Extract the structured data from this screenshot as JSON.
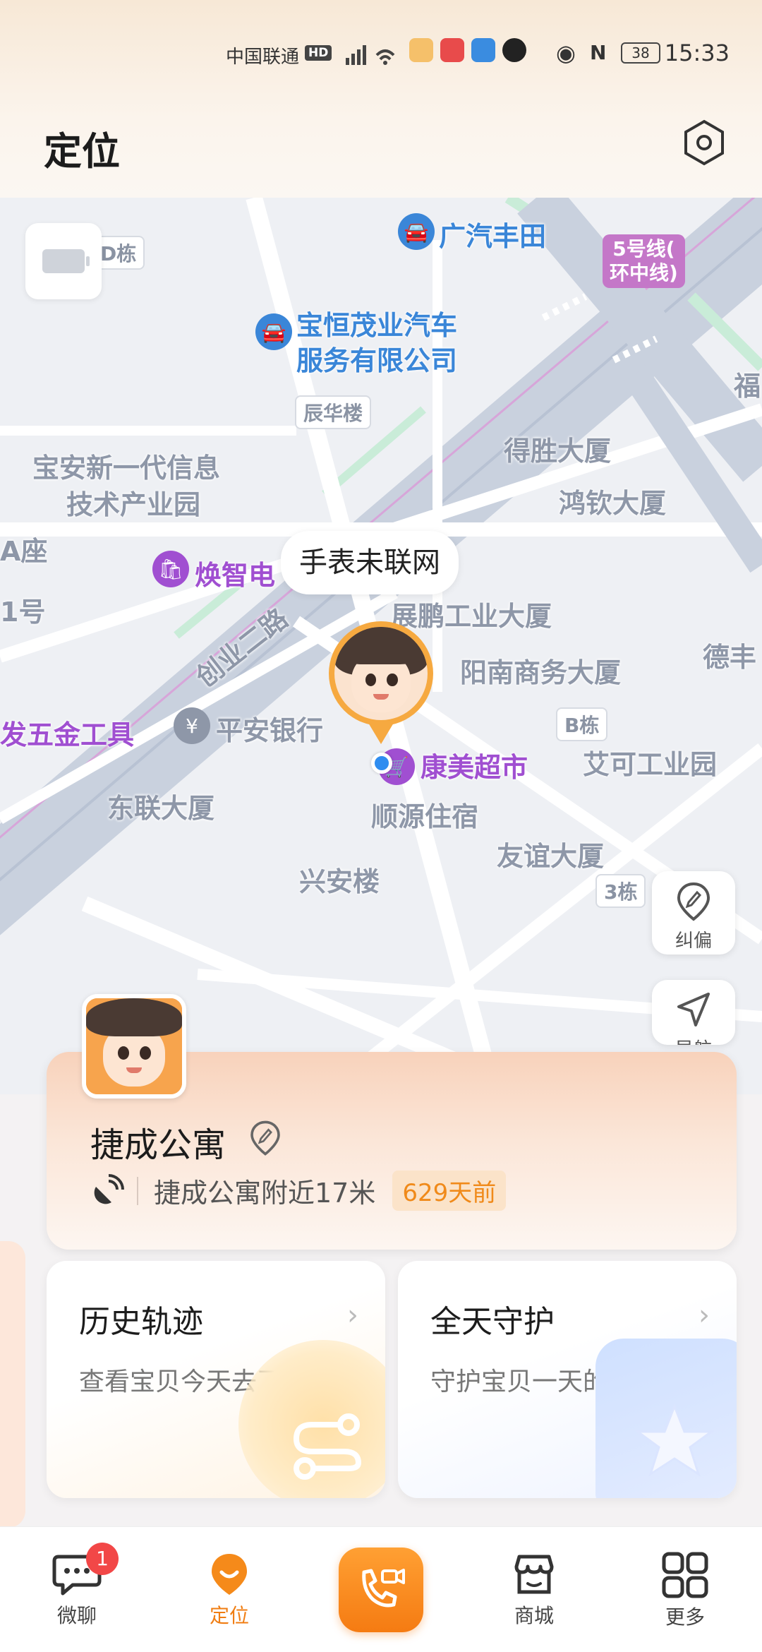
{
  "status_bar": {
    "carrier": "中国联通",
    "hd": "HD",
    "battery": "38",
    "time": "15:33"
  },
  "header": {
    "title": "定位"
  },
  "map": {
    "offline_bubble": "手表未联网",
    "pois": {
      "d_building": "D栋",
      "gac_toyota": "广汽丰田",
      "metro_line": "5号线(\n环中线)",
      "baoheng_line1": "宝恒茂业汽车",
      "baoheng_line2": "服务有限公司",
      "fu": "福",
      "chenhua": "辰华楼",
      "baoan_park_line1": "宝安新一代信息",
      "baoan_park_line2": "技术产业园",
      "desheng": "得胜大厦",
      "hongqin": "鸿钦大厦",
      "a_block": "A座",
      "no1": "1号",
      "huanzhi": "焕智电",
      "zhanpeng": "展鹏工业大厦",
      "chuangye_road": "创业二路",
      "yangnan": "阳南商务大厦",
      "defeng": "德丰",
      "hardware": "发五金工具",
      "pingan": "平安银行",
      "b_building": "B栋",
      "kangmei": "康美超市",
      "aike": "艾可工业园",
      "donglian": "东联大厦",
      "shunyuan": "顺源住宿",
      "youyi": "友谊大厦",
      "xingan": "兴安楼",
      "building3": "3栋"
    },
    "buttons": {
      "correct_label": "纠偏",
      "navigate_label": "导航"
    }
  },
  "location_card": {
    "name": "捷成公寓",
    "detail": "捷成公寓附近17米",
    "age": "629天前"
  },
  "features": [
    {
      "title": "历史轨迹",
      "subtitle": "查看宝贝今天去了哪里"
    },
    {
      "title": "全天守护",
      "subtitle": "守护宝贝一天的行程"
    }
  ],
  "nav": {
    "chat": "微聊",
    "chat_badge": "1",
    "location": "定位",
    "mall": "商城",
    "more": "更多"
  },
  "colors": {
    "accent": "#f07d12",
    "poi_blue": "#3a86d8",
    "poi_purple": "#a04fd1",
    "badge_red": "#f24747"
  }
}
